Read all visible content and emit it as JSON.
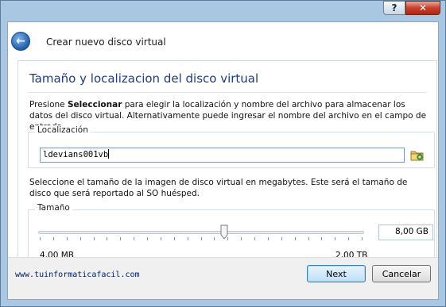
{
  "window": {
    "help_glyph": "?",
    "close_glyph": "✕"
  },
  "header": {
    "back_glyph": "←",
    "title": "Crear nuevo disco virtual"
  },
  "page": {
    "title": "Tamaño y localizacion del disco virtual",
    "intro_prefix": "Presione ",
    "intro_bold": "Seleccionar",
    "intro_suffix": " para elegir la localización y nombre del archivo para almacenar los datos del disco virtual. Alternativamente puede ingresar el nombre del archivo en el campo de entrada."
  },
  "location": {
    "group_label": "Localización",
    "value": "ldevians001vb"
  },
  "size": {
    "description": "Seleccione el tamaño de la imagen de disco virtual en megabytes. Este será el tamaño de disco que será reportado al SO huésped.",
    "group_label": "Tamaño",
    "slider_fraction": 0.57,
    "value": "8,00 GB",
    "min_label": "4,00 MB",
    "max_label": "2,00 TB"
  },
  "footer": {
    "website": "www.tuinformaticafacil.com",
    "next_label": "Next",
    "cancel_label": "Cancelar"
  },
  "colors": {
    "title_blue": "#1e3d7a",
    "frame": "#a9c7e3"
  }
}
